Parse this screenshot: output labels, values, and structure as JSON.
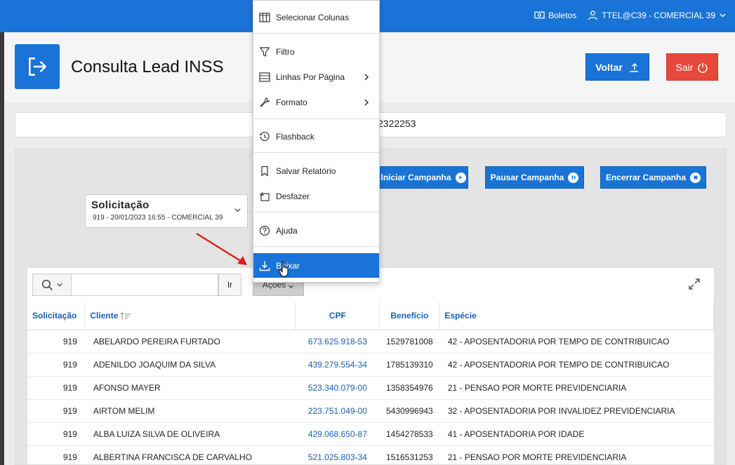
{
  "topbar": {
    "boletos_label": "Boletos",
    "user_label": "TTEL@C39 - COMERCIAL 39"
  },
  "header": {
    "title": "Consulta Lead INSS",
    "back_label": "Voltar",
    "exit_label": "Sair"
  },
  "info": {
    "partial_text": "2322253"
  },
  "campaign": {
    "start_label": "Iniciar Campanha",
    "pause_label": "Pausar Campanha",
    "end_label": "Encerrar Campanha"
  },
  "solicitacao": {
    "label": "Solicitação",
    "value": "919 - 20/01/2023 16:55 - COMERCIAL 39"
  },
  "toolbar": {
    "go_label": "Ir",
    "actions_label": "Ações"
  },
  "menu": {
    "items": [
      {
        "label": "Selecionar Colunas",
        "icon": "columns-icon"
      },
      {
        "label": "Filtro",
        "icon": "filter-icon"
      },
      {
        "label": "Linhas Por Página",
        "icon": "rows-icon",
        "submenu": true
      },
      {
        "label": "Formato",
        "icon": "wrench-icon",
        "submenu": true
      },
      {
        "label": "Flashback",
        "icon": "clock-icon"
      },
      {
        "label": "Salvar Relatório",
        "icon": "bookmark-icon"
      },
      {
        "label": "Desfazer",
        "icon": "undo-icon"
      },
      {
        "label": "Ajuda",
        "icon": "help-icon"
      },
      {
        "label": "Baixar",
        "icon": "download-icon",
        "active": true
      }
    ]
  },
  "table": {
    "columns": [
      "Solicitação",
      "Cliente",
      "CPF",
      "Benefício",
      "Espécie"
    ],
    "rows": [
      {
        "solicitacao": "919",
        "cliente": "ABELARDO PEREIRA FURTADO",
        "cpf": "673.625.918-53",
        "beneficio": "1529781008",
        "especie": "42 - APOSENTADORIA POR TEMPO DE CONTRIBUICAO"
      },
      {
        "solicitacao": "919",
        "cliente": "ADENILDO JOAQUIM DA SILVA",
        "cpf": "439.279.554-34",
        "beneficio": "1785139310",
        "especie": "42 - APOSENTADORIA POR TEMPO DE CONTRIBUICAO"
      },
      {
        "solicitacao": "919",
        "cliente": "AFONSO MAYER",
        "cpf": "523.340.079-00",
        "beneficio": "1358354976",
        "especie": "21 - PENSAO POR MORTE PREVIDENCIARIA"
      },
      {
        "solicitacao": "919",
        "cliente": "AIRTOM MELIM",
        "cpf": "223.751.049-00",
        "beneficio": "5430996943",
        "especie": "32 - APOSENTADORIA POR INVALIDEZ PREVIDENCIARIA"
      },
      {
        "solicitacao": "919",
        "cliente": "ALBA LUIZA SILVA DE OLIVEIRA",
        "cpf": "429.068.650-87",
        "beneficio": "1454278533",
        "especie": "41 - APOSENTADORIA POR IDADE"
      },
      {
        "solicitacao": "919",
        "cliente": "ALBERTINA FRANCISCA DE CARVALHO",
        "cpf": "521.025.803-34",
        "beneficio": "1516531253",
        "especie": "21 - PENSAO POR MORTE PREVIDENCIARIA"
      }
    ]
  },
  "colors": {
    "primary": "#1a73d6",
    "danger": "#e8483c",
    "link": "#1a5fb4",
    "annotation": "#e0201a"
  }
}
